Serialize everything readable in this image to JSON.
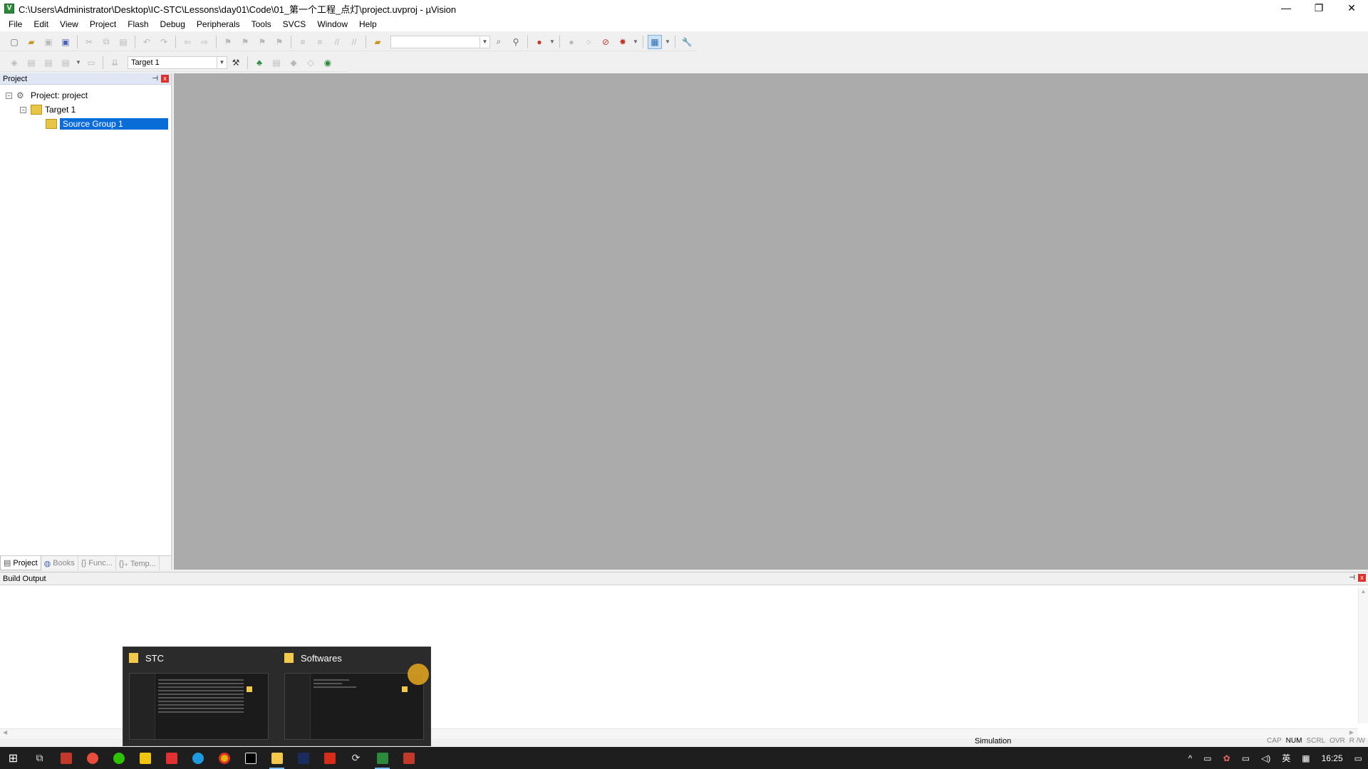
{
  "window": {
    "title": "C:\\Users\\Administrator\\Desktop\\IC-STC\\Lessons\\day01\\Code\\01_第一个工程_点灯\\project.uvproj - µVision",
    "minimize": "—",
    "restore": "❐",
    "close": "✕"
  },
  "menu": [
    "File",
    "Edit",
    "View",
    "Project",
    "Flash",
    "Debug",
    "Peripherals",
    "Tools",
    "SVCS",
    "Window",
    "Help"
  ],
  "toolbar2": {
    "target": "Target 1"
  },
  "project_panel": {
    "title": "Project",
    "pin": "⊣",
    "close": "x",
    "tree": {
      "root": "Project: project",
      "target": "Target 1",
      "group": "Source Group 1"
    },
    "tabs": [
      "Project",
      "Books",
      "{} Func...",
      "{}₊ Temp..."
    ]
  },
  "build_output": {
    "title": "Build Output"
  },
  "status": {
    "mode": "Simulation",
    "indicators": [
      "CAP",
      "NUM",
      "SCRL",
      "OVR",
      "R /W"
    ],
    "active_indicator": "NUM"
  },
  "thumbnails": [
    {
      "title": "STC"
    },
    {
      "title": "Softwares"
    }
  ],
  "tray": {
    "chevron": "^",
    "ime": "英",
    "clock": "16:25"
  },
  "colors": {
    "editor_bg": "#ababab",
    "selection": "#0a6cd6",
    "taskbar": "#1e1e1e"
  }
}
